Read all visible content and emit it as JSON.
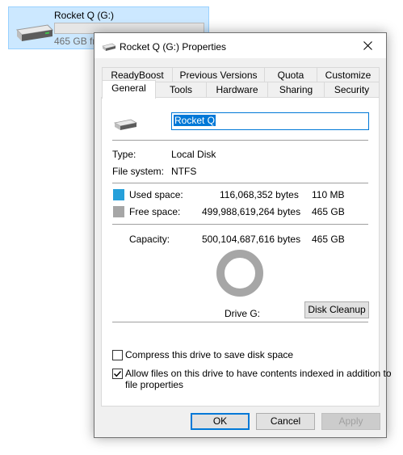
{
  "background_tile": {
    "drive_name": "Rocket Q (G:)",
    "free_text": "465 GB free of 465 GB",
    "used_fraction": 0.0002
  },
  "dialog": {
    "title": "Rocket Q (G:) Properties",
    "close_label": "✕",
    "tabs_row1": [
      "ReadyBoost",
      "Previous Versions",
      "Quota",
      "Customize"
    ],
    "tabs_row2": [
      "General",
      "Tools",
      "Hardware",
      "Sharing",
      "Security"
    ],
    "selected_tab": "General",
    "general": {
      "name_value": "Rocket Q",
      "type_label": "Type:",
      "type_value": "Local Disk",
      "fs_label": "File system:",
      "fs_value": "NTFS",
      "used_label": "Used space:",
      "used_bytes": "116,068,352 bytes",
      "used_size": "110 MB",
      "used_color": "#26a0da",
      "free_label": "Free space:",
      "free_bytes": "499,988,619,264 bytes",
      "free_size": "465 GB",
      "free_color": "#a6a6a6",
      "capacity_label": "Capacity:",
      "capacity_bytes": "500,104,687,616 bytes",
      "capacity_size": "465 GB",
      "drive_label": "Drive G:",
      "cleanup_button": "Disk Cleanup",
      "compress_label": "Compress this drive to save disk space",
      "compress_checked": false,
      "index_label_line1": "Allow files on this drive to have contents indexed in addition to",
      "index_label_line2": "file properties",
      "index_checked": true
    },
    "buttons": {
      "ok": "OK",
      "cancel": "Cancel",
      "apply": "Apply"
    }
  }
}
